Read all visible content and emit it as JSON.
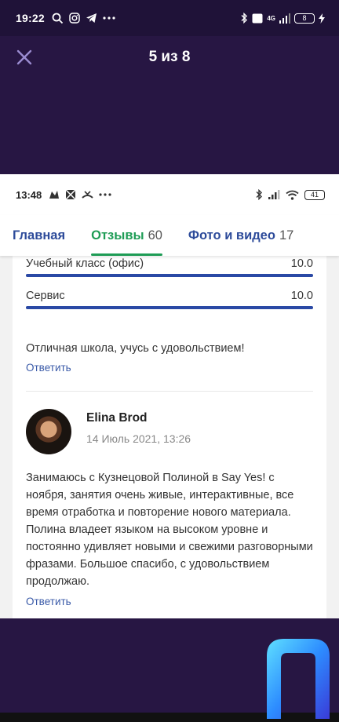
{
  "outer_status": {
    "time": "19:22",
    "network": "4G",
    "battery": "8"
  },
  "viewer": {
    "counter": "5 из 8"
  },
  "inner_status": {
    "time": "13:48",
    "battery": "41"
  },
  "tabs": [
    {
      "label": "Главная",
      "count": ""
    },
    {
      "label": "Отзывы",
      "count": "60"
    },
    {
      "label": "Фото и видео",
      "count": "17"
    }
  ],
  "ratings": [
    {
      "label": "Учебный класс (офис)",
      "value": "10.0",
      "fill": 1.0
    },
    {
      "label": "Сервис",
      "value": "10.0",
      "fill": 1.0
    }
  ],
  "review1": {
    "text": "Отличная школа, учусь с удовольствием!",
    "reply": "Ответить"
  },
  "review2": {
    "author": "Elina Brod",
    "date": "14 Июль 2021, 13:26",
    "text": "Занимаюсь с Кузнецовой Полиной в Say Yes! с ноября, занятия очень живые, интерактивные, все время отработка и повторение нового материала. Полина владеет языком на высоком уровне и постоянно удивляет новыми и свежими разговорными фразами. Большое спасибо, с удовольствием продолжаю.",
    "reply": "Ответить"
  },
  "colors": {
    "background": "#271643",
    "accent_green": "#1e9c55",
    "link_blue": "#2d4b9a",
    "bar_blue": "#2a49a5"
  }
}
